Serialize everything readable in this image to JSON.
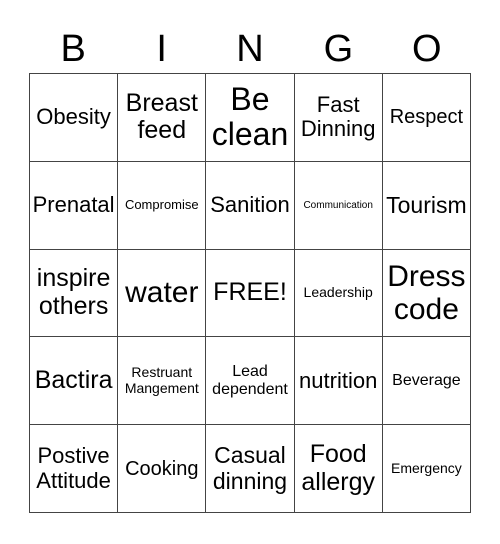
{
  "header": {
    "letters": [
      "B",
      "I",
      "N",
      "G",
      "O"
    ]
  },
  "cells": [
    [
      "Obesity",
      "Breast\nfeed",
      "Be\nclean",
      "Fast\nDinning",
      "Respect"
    ],
    [
      "Prenatal",
      "Compromise",
      "Sanition",
      "Communication",
      "Tourism"
    ],
    [
      "inspire\nothers",
      "water",
      "FREE!",
      "Leadership",
      "Dress\ncode"
    ],
    [
      "Bactira",
      "Restruant\nMangement",
      "Lead\ndependent",
      "nutrition",
      "Beverage"
    ],
    [
      "Postive\nAttitude",
      "Cooking",
      "Casual\ndinning",
      "Food\nallergy",
      "Emergency"
    ]
  ]
}
